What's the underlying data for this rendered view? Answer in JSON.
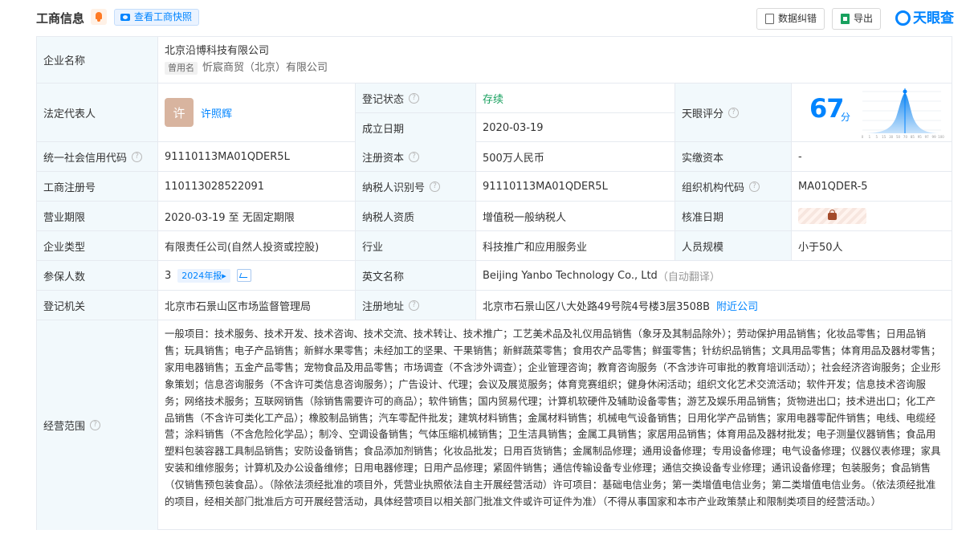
{
  "header": {
    "title": "工商信息",
    "snapshot_label": "查看工商快照",
    "correct_label": "数据纠错",
    "export_label": "导出",
    "logo_text": "天眼查"
  },
  "labels": {
    "company_name": "企业名称",
    "legal_rep": "法定代表人",
    "reg_status": "登记状态",
    "est_date": "成立日期",
    "tianyan_score": "天眼评分",
    "credit_code": "统一社会信用代码",
    "reg_capital": "注册资本",
    "paid_capital": "实缴资本",
    "reg_no": "工商注册号",
    "taxpayer_id": "纳税人识别号",
    "org_code": "组织机构代码",
    "biz_term": "营业期限",
    "taxpayer_qual": "纳税人资质",
    "approval_date": "核准日期",
    "company_type": "企业类型",
    "industry": "行业",
    "staff_size": "人员规模",
    "insured": "参保人数",
    "english_name": "英文名称",
    "reg_authority": "登记机关",
    "reg_address": "注册地址",
    "biz_scope": "经营范围"
  },
  "values": {
    "company_name": "北京沿博科技有限公司",
    "former_tag": "曾用名",
    "former_name": "忻宸商贸（北京）有限公司",
    "avatar_char": "许",
    "legal_rep": "许照辉",
    "reg_status": "存续",
    "est_date": "2020-03-19",
    "score": "67",
    "score_unit": "分",
    "credit_code": "91110113MA01QDER5L",
    "reg_capital": "500万人民币",
    "paid_capital": "-",
    "reg_no": "110113028522091",
    "taxpayer_id": "91110113MA01QDER5L",
    "org_code": "MA01QDER-5",
    "biz_term": "2020-03-19 至 无固定期限",
    "taxpayer_qual": "增值税一般纳税人",
    "company_type": "有限责任公司(自然人投资或控股)",
    "industry": "科技推广和应用服务业",
    "staff_size": "小于50人",
    "insured": "3",
    "insured_year": "2024年报",
    "english_name": "Beijing Yanbo Technology Co., Ltd",
    "english_note": "（自动翻译）",
    "reg_authority": "北京市石景山区市场监督管理局",
    "reg_address": "北京市石景山区八大处路49号院4号楼3层3508B",
    "nearby_link": "附近公司",
    "biz_scope": "一般项目：技术服务、技术开发、技术咨询、技术交流、技术转让、技术推广；工艺美术品及礼仪用品销售（象牙及其制品除外）；劳动保护用品销售；化妆品零售；日用品销售；玩具销售；电子产品销售；新鲜水果零售；未经加工的坚果、干果销售；新鲜蔬菜零售；食用农产品零售；鲜蛋零售；针纺织品销售；文具用品零售；体育用品及器材零售；家用电器销售；五金产品零售；宠物食品及用品零售；市场调查（不含涉外调查）；企业管理咨询；教育咨询服务（不含涉许可审批的教育培训活动）；社会经济咨询服务；企业形象策划；信息咨询服务（不含许可类信息咨询服务）；广告设计、代理；会议及展览服务；体育竞赛组织；健身休闲活动；组织文化艺术交流活动；软件开发；信息技术咨询服务；网络技术服务；互联网销售（除销售需要许可的商品）；软件销售；国内贸易代理；计算机软硬件及辅助设备零售；游艺及娱乐用品销售；货物进出口；技术进出口；化工产品销售（不含许可类化工产品）；橡胶制品销售；汽车零配件批发；建筑材料销售；金属材料销售；机械电气设备销售；日用化学产品销售；家用电器零配件销售；电线、电缆经营；涂料销售（不含危险化学品）；制冷、空调设备销售；气体压缩机械销售；卫生洁具销售；金属工具销售；家居用品销售；体育用品及器材批发；电子测量仪器销售；食品用塑料包装容器工具制品销售；安防设备销售；食品添加剂销售；化妆品批发；日用百货销售；金属制品修理；通用设备修理；专用设备修理；电气设备修理；仪器仪表修理；家具安装和维修服务；计算机及办公设备维修；日用电器修理；日用产品修理；紧固件销售；通信传输设备专业修理；通信交换设备专业修理；通讯设备修理；包装服务；食品销售（仅销售预包装食品）。（除依法须经批准的项目外，凭营业执照依法自主开展经营活动）许可项目：基础电信业务；第一类增值电信业务；第二类增值电信业务。（依法须经批准的项目，经相关部门批准后方可开展经营活动，具体经营项目以相关部门批准文件或许可证件为准）（不得从事国家和本市产业政策禁止和限制类项目的经营活动。）"
  },
  "score_chart": {
    "x_ticks": [
      "0",
      "1",
      "5",
      "15",
      "30",
      "50",
      "70",
      "85",
      "95",
      "97",
      "99",
      "100"
    ]
  },
  "colors": {
    "accent": "#0084ff",
    "label_bg": "#f2f9fc",
    "status_green": "#19a15f"
  }
}
